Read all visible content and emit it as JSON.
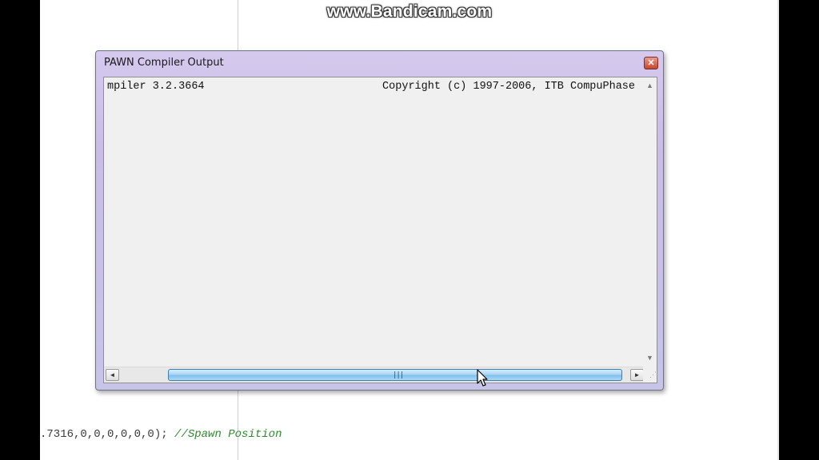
{
  "watermark": "www.Bandicam.com",
  "background_editor": {
    "code": ".7316,0,0,0,0,0,0);",
    "comment": "//Spawn Position"
  },
  "window": {
    "title": "PAWN Compiler Output",
    "close_glyph": "✕",
    "output_left": "mpiler 3.2.3664",
    "output_right": "Copyright (c) 1997-2006, ITB CompuPhase"
  },
  "scrollbars": {
    "horizontal_left_arrow": "◄",
    "horizontal_right_arrow": "►",
    "vertical_up_arrow": "▲",
    "vertical_down_arrow": "▼",
    "thumb_grip": "|||"
  },
  "colors": {
    "frame": "#c9bde6",
    "client_bg": "#f0f0f0",
    "thumb": "#a9d5f4",
    "comment": "#2e8b2e"
  }
}
